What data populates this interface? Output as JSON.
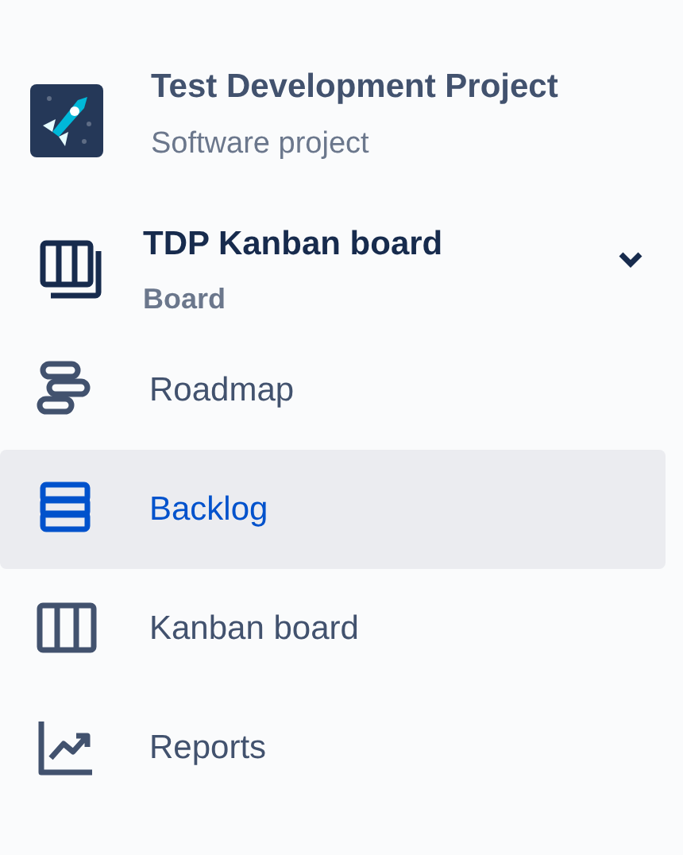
{
  "project": {
    "name": "Test Development Project",
    "type": "Software project"
  },
  "board": {
    "name": "TDP Kanban board",
    "subtitle": "Board"
  },
  "nav_items": [
    {
      "kind": "roadmap",
      "label": "Roadmap",
      "selected": false
    },
    {
      "kind": "backlog",
      "label": "Backlog",
      "selected": true
    },
    {
      "kind": "board",
      "label": "Kanban board",
      "selected": false
    },
    {
      "kind": "reports",
      "label": "Reports",
      "selected": false
    }
  ]
}
